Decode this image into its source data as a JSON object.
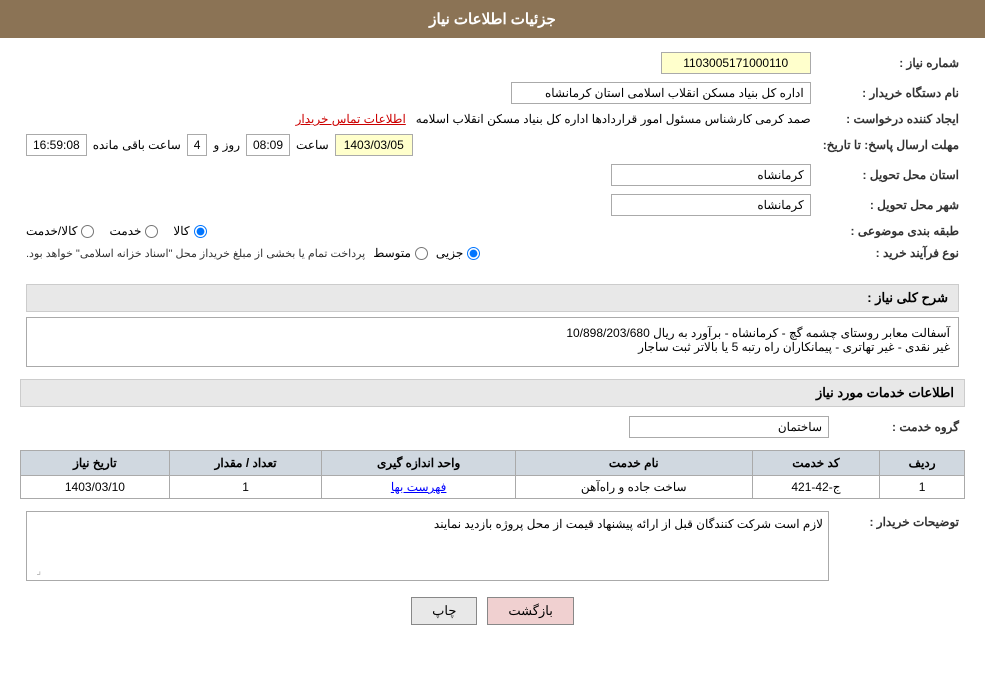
{
  "header": {
    "title": "جزئیات اطلاعات نیاز"
  },
  "fields": {
    "niyaz_number_label": "شماره نیاز :",
    "niyaz_number_value": "1103005171000110",
    "buyer_org_label": "نام دستگاه خریدار :",
    "buyer_org_value": "اداره کل بنیاد مسکن انقلاب اسلامی استان کرمانشاه",
    "creator_label": "ایجاد کننده درخواست :",
    "creator_value": "صمد کرمی کارشناس مسئول امور قراردادها اداره کل بنیاد مسکن انقلاب اسلامه",
    "contact_link": "اطلاعات تماس خریدار",
    "response_deadline_label": "مهلت ارسال پاسخ: تا تاریخ:",
    "deadline_date": "1403/03/05",
    "deadline_time_label": "ساعت",
    "deadline_time": "08:09",
    "deadline_day_label": "روز و",
    "deadline_days": "4",
    "remaining_label": "ساعت باقی مانده",
    "remaining_time": "16:59:08",
    "delivery_province_label": "استان محل تحویل :",
    "delivery_province_value": "کرمانشاه",
    "delivery_city_label": "شهر محل تحویل :",
    "delivery_city_value": "کرمانشاه",
    "category_label": "طبقه بندی موضوعی :",
    "category_kala": "کالا",
    "category_khedmat": "خدمت",
    "category_kala_khedmat": "کالا/خدمت",
    "process_label": "نوع فرآیند خرید :",
    "process_jozi": "جزیی",
    "process_motavaset": "متوسط",
    "process_note": "پرداخت تمام یا بخشی از مبلغ خریداز محل \"اسناد خزانه اسلامی\" خواهد بود.",
    "description_label": "شرح کلی نیاز :",
    "description_value": "آسفالت معابر روستای چشمه گچ - کرمانشاه - برآورد به ریال 10/898/203/680\nغیر نقدی - غیر تهاتری - پیمانکاران راه رتبه 5 یا بالاتر ثبت ساجار",
    "services_section_label": "اطلاعات خدمات مورد نیاز",
    "service_group_label": "گروه خدمت :",
    "service_group_value": "ساختمان",
    "table": {
      "headers": [
        "ردیف",
        "کد خدمت",
        "نام خدمت",
        "واحد اندازه گیری",
        "تعداد / مقدار",
        "تاریخ نیاز"
      ],
      "rows": [
        {
          "row": "1",
          "code": "ج-42-421",
          "name": "ساخت جاده و راه‌آهن",
          "unit": "فهرست بها",
          "quantity": "1",
          "date": "1403/03/10"
        }
      ]
    },
    "buyer_notes_label": "توضیحات خریدار :",
    "buyer_notes_value": "لازم است شرکت کنندگان قبل از ارائه پیشنهاد قیمت از محل پروژه بازدید نمایند"
  },
  "buttons": {
    "print_label": "چاپ",
    "back_label": "بازگشت"
  }
}
